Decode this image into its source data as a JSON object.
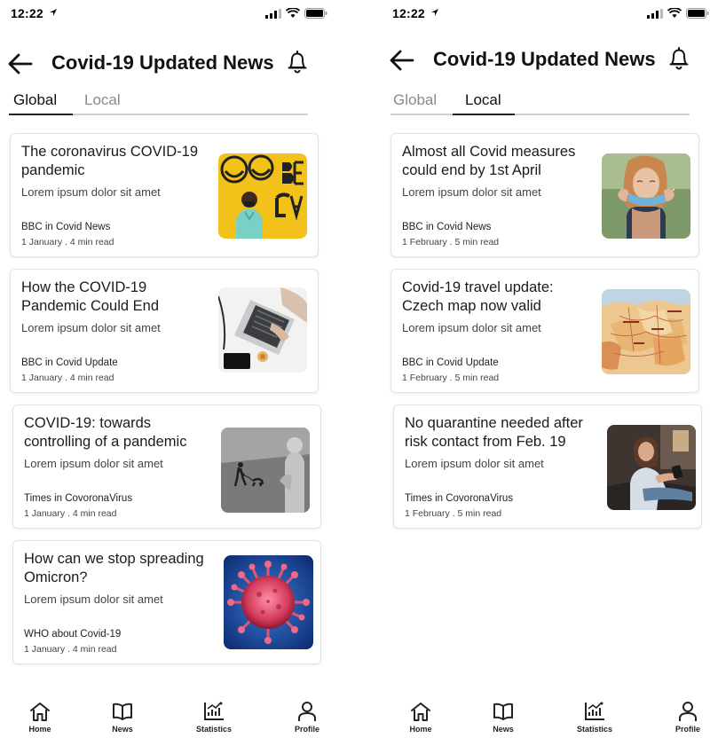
{
  "status_bar": {
    "time": "12:22"
  },
  "header": {
    "title": "Covid-19 Updated News"
  },
  "tabs": [
    "Global",
    "Local"
  ],
  "screens": [
    {
      "active_tab": "Global",
      "cards": [
        {
          "title": "The coronavirus COVID-19 pandemic",
          "subtitle": "Lorem ipsum dolor sit amet",
          "source": "BBC in Covid News",
          "meta": "1 January .  4 min read",
          "image": "masked-man-mural-photo"
        },
        {
          "title": "How the COVID-19 Pandemic Could End",
          "subtitle": "Lorem ipsum dolor sit amet",
          "source": "BBC in Covid Update",
          "meta": "1 January .  4 min read",
          "image": "laptop-desk-photo"
        },
        {
          "title": "COVID-19: towards controlling of a pandemic",
          "subtitle": "Lorem ipsum dolor sit amet",
          "source": "Times  in CovoronaVirus",
          "meta": "1 January .  4 min read",
          "image": "statue-street-photo"
        },
        {
          "title": "How can we stop spreading Omicron?",
          "subtitle": "Lorem ipsum dolor sit amet",
          "source": "WHO about Covid-19",
          "meta": "1 January .  4 min read",
          "image": "virus-particle-photo"
        }
      ]
    },
    {
      "active_tab": "Local",
      "cards": [
        {
          "title": "Almost all Covid measures could end by 1st April",
          "subtitle": "Lorem ipsum dolor sit amet",
          "source": "BBC in Covid News",
          "meta": "1 February .  5 min read",
          "image": "woman-removing-mask-photo"
        },
        {
          "title": "Covid-19 travel update: Czech map now valid",
          "subtitle": "Lorem ipsum dolor sit amet",
          "source": "BBC in Covid Update",
          "meta": "1 February .  5 min read",
          "image": "europe-map-photo"
        },
        {
          "title": "No quarantine needed after risk contact from Feb. 19",
          "subtitle": "Lorem ipsum dolor sit amet",
          "source": "Times  in CovoronaVirus",
          "meta": "1 February .  5 min read",
          "image": "woman-phone-photo"
        }
      ]
    }
  ],
  "bottom_nav": [
    {
      "label": "Home",
      "icon": "home-icon"
    },
    {
      "label": "News",
      "icon": "book-icon"
    },
    {
      "label": "Statistics",
      "icon": "statistics-icon"
    },
    {
      "label": "Profile",
      "icon": "profile-icon"
    }
  ],
  "colors": {
    "text": "#1c1c1c",
    "muted": "#8a8a8a",
    "border": "#e3e3e3",
    "tab_line": "#d0d0d0"
  }
}
